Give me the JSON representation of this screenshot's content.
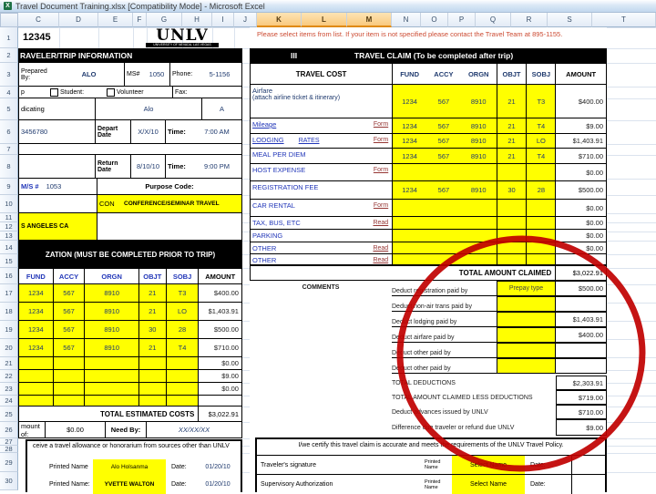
{
  "window": {
    "title": "Travel Document Training.xlsx [Compatibility Mode] - Microsoft Excel"
  },
  "grid": {
    "columns": [
      "C",
      "D",
      "E",
      "F",
      "G",
      "H",
      "I",
      "J",
      "K",
      "L",
      "M",
      "N",
      "O",
      "P",
      "Q",
      "R",
      "S",
      "T"
    ],
    "selected_columns": [
      "K",
      "L",
      "M"
    ],
    "rows": [
      "1",
      "2",
      "3",
      "4",
      "5",
      "6",
      "7",
      "8",
      "9",
      "10",
      "11",
      "12",
      "13",
      "14",
      "15",
      "16",
      "17",
      "18",
      "19",
      "20",
      "21",
      "22",
      "23",
      "24",
      "25",
      "26",
      "27",
      "28",
      "29",
      "30"
    ]
  },
  "sheet": {
    "c1_value": "12345",
    "logo": {
      "title": "UNLV",
      "subtitle": "UNIVERSITY OF NEVADA, LAS VEGAS"
    },
    "note": "Please select items from list. If your item is not specified please contact the Travel Team at 895-1155."
  },
  "traveler": {
    "header": "RAVELER/TRIP INFORMATION",
    "prepared_by_label": "Prepared By:",
    "prepared_by": "ALO",
    "ms_label": "MS#",
    "ms_value": "1050",
    "phone_label": "Phone:",
    "phone_value": "5-1156",
    "row4_left": "p",
    "student_label": "Student:",
    "volunteer_label": "Volunteer",
    "fax_label": "Fax:",
    "row5_left": "dicating",
    "row5_mid": "Alo",
    "row5_right": "A",
    "traveler_id": "3456780",
    "depart_label": "Depart Date",
    "depart_date": "X/X/10",
    "depart_time_label": "Time:",
    "depart_time": "7:00 AM",
    "return_label": "Return Date",
    "return_date": "8/10/10",
    "return_time_label": "Time:",
    "return_time": "9:00 PM",
    "ms2_label": "M/S #",
    "ms2_value": "1053",
    "purpose_label": "Purpose Code:",
    "purpose_code": "CON",
    "purpose_desc": "CONFERENCE/SEMINAR TRAVEL",
    "destination": "S ANGELES CA"
  },
  "authorization": {
    "header": "ZATION (MUST BE COMPLETED PRIOR TO TRIP)",
    "col_headers": {
      "fund": "FUND",
      "accy": "ACCY",
      "orgn": "ORGN",
      "objt": "OBJT",
      "sobj": "SOBJ",
      "amount": "AMOUNT"
    },
    "rows": [
      {
        "fund": "1234",
        "accy": "567",
        "orgn": "8910",
        "objt": "21",
        "sobj": "T3",
        "amount": "$400.00"
      },
      {
        "fund": "1234",
        "accy": "567",
        "orgn": "8910",
        "objt": "21",
        "sobj": "LO",
        "amount": "$1,403.91"
      },
      {
        "fund": "1234",
        "accy": "567",
        "orgn": "8910",
        "objt": "30",
        "sobj": "28",
        "amount": "$500.00"
      },
      {
        "fund": "1234",
        "accy": "567",
        "orgn": "8910",
        "objt": "21",
        "sobj": "T4",
        "amount": "$710.00"
      },
      {
        "fund": "",
        "accy": "",
        "orgn": "",
        "objt": "",
        "sobj": "",
        "amount": "$0.00"
      },
      {
        "fund": "",
        "accy": "",
        "orgn": "",
        "objt": "",
        "sobj": "",
        "amount": "$9.00"
      },
      {
        "fund": "",
        "accy": "",
        "orgn": "",
        "objt": "",
        "sobj": "",
        "amount": "$0.00"
      },
      {
        "fund": "",
        "accy": "",
        "orgn": "",
        "objt": "",
        "sobj": "",
        "amount": ""
      }
    ],
    "total_label": "TOTAL ESTIMATED COSTS",
    "total_amount": "$3,022.91",
    "advance_label": "mount of:",
    "advance_amount": "$0.00",
    "need_by_label": "Need By:",
    "need_by": "XX/XX/XX",
    "allowance_text": "ceive a travel allowance or honorarium from sources other than UNLV",
    "signatures": [
      {
        "label": "Printed Name",
        "name": "Alo Holsanma",
        "date_label": "Date:",
        "date": "01/20/10"
      },
      {
        "label": "Printed Name:",
        "name": "YVETTE WALTON",
        "date_label": "Date:",
        "date": "01/20/10"
      }
    ]
  },
  "claim": {
    "section_number": "III",
    "header": "TRAVEL CLAIM (To be completed after trip)",
    "col_headers": {
      "cost": "TRAVEL COST",
      "fund": "FUND",
      "accy": "ACCY",
      "orgn": "ORGN",
      "objt": "OBJT",
      "sobj": "SOBJ",
      "amount": "AMOUNT"
    },
    "cost_rows": [
      {
        "label": "Airfare",
        "label2": "(attach airline ticket & itinerary)",
        "link": "",
        "fund": "1234",
        "accy": "567",
        "orgn": "8910",
        "objt": "21",
        "sobj": "T3",
        "amount": "$400.00"
      },
      {
        "label": "Mileage",
        "label2": "",
        "link": "Form",
        "fund": "1234",
        "accy": "567",
        "orgn": "8910",
        "objt": "21",
        "sobj": "T4",
        "amount": "$9.00"
      },
      {
        "label": "LODGING",
        "label2": "RATES",
        "link": "Form",
        "fund": "1234",
        "accy": "567",
        "orgn": "8910",
        "objt": "21",
        "sobj": "LO",
        "amount": "$1,403.91"
      },
      {
        "label": "MEAL PER DIEM",
        "label2": "",
        "link": "",
        "fund": "1234",
        "accy": "567",
        "orgn": "8910",
        "objt": "21",
        "sobj": "T4",
        "amount": "$710.00"
      },
      {
        "label": "HOST EXPENSE",
        "label2": "",
        "link": "Form",
        "fund": "",
        "accy": "",
        "orgn": "",
        "objt": "",
        "sobj": "",
        "amount": "$0.00"
      },
      {
        "label": "REGISTRATION FEE",
        "label2": "",
        "link": "",
        "fund": "1234",
        "accy": "567",
        "orgn": "8910",
        "objt": "30",
        "sobj": "28",
        "amount": "$500.00"
      },
      {
        "label": "CAR RENTAL",
        "label2": "",
        "link": "Form",
        "fund": "",
        "accy": "",
        "orgn": "",
        "objt": "",
        "sobj": "",
        "amount": "$0.00"
      },
      {
        "label": "TAX, BUS, ETC",
        "label2": "",
        "link": "Read",
        "fund": "",
        "accy": "",
        "orgn": "",
        "objt": "",
        "sobj": "",
        "amount": "$0.00"
      },
      {
        "label": "PARKING",
        "label2": "",
        "link": "",
        "fund": "",
        "accy": "",
        "orgn": "",
        "objt": "",
        "sobj": "",
        "amount": "$0.00"
      },
      {
        "label": "OTHER",
        "label2": "",
        "link": "Read",
        "fund": "",
        "accy": "",
        "orgn": "",
        "objt": "",
        "sobj": "",
        "amount": "$0.00"
      },
      {
        "label": "OTHER",
        "label2": "",
        "link": "Read",
        "fund": "",
        "accy": "",
        "orgn": "",
        "objt": "",
        "sobj": "",
        "amount": ""
      }
    ],
    "total_label": "TOTAL AMOUNT CLAIMED",
    "total_amount": "$3,022.91",
    "comments_label": "COMMENTS",
    "deductions": [
      {
        "label": "Deduct registration paid by",
        "value": "Prepay type",
        "amount": "$500.00"
      },
      {
        "label": "Deduct non-air trans paid by",
        "value": "",
        "amount": ""
      },
      {
        "label": "Deduct lodging paid by",
        "value": "",
        "amount": "$1,403.91"
      },
      {
        "label": "Deduct airfare paid by",
        "value": "",
        "amount": "$400.00"
      },
      {
        "label": "Deduct other paid by",
        "value": "",
        "amount": ""
      },
      {
        "label": "Deduct other paid by",
        "value": "",
        "amount": ""
      }
    ],
    "summary": [
      {
        "label": "TOTAL DEDUCTIONS",
        "amount": "$2,303.91"
      },
      {
        "label": "TOTAL AMOUNT CLAIMED LESS DEDUCTIONS",
        "amount": "$719.00"
      },
      {
        "label": "Deduct advances issued by UNLV",
        "amount": "$710.00"
      },
      {
        "label": "Difference due traveler or refund due UNLV",
        "amount": "$9.00"
      }
    ],
    "certify_text": "I/we certify this travel claim is accurate and meets the requirements of the UNLV Travel Policy.",
    "signature_rows": [
      {
        "label": "Traveler's signature",
        "printed_label": "Printed Name",
        "select_value": "Select Name",
        "date_label": "Date:"
      },
      {
        "label": "Supervisory Authorization",
        "printed_label": "Printed Name",
        "select_value": "Select Name",
        "date_label": "Date:"
      }
    ]
  },
  "annotation": {
    "circle_color": "#C00000"
  },
  "colors": {
    "highlight": "#FFFF00",
    "note_text": "#CC4A31",
    "header_bg": "#000000"
  }
}
